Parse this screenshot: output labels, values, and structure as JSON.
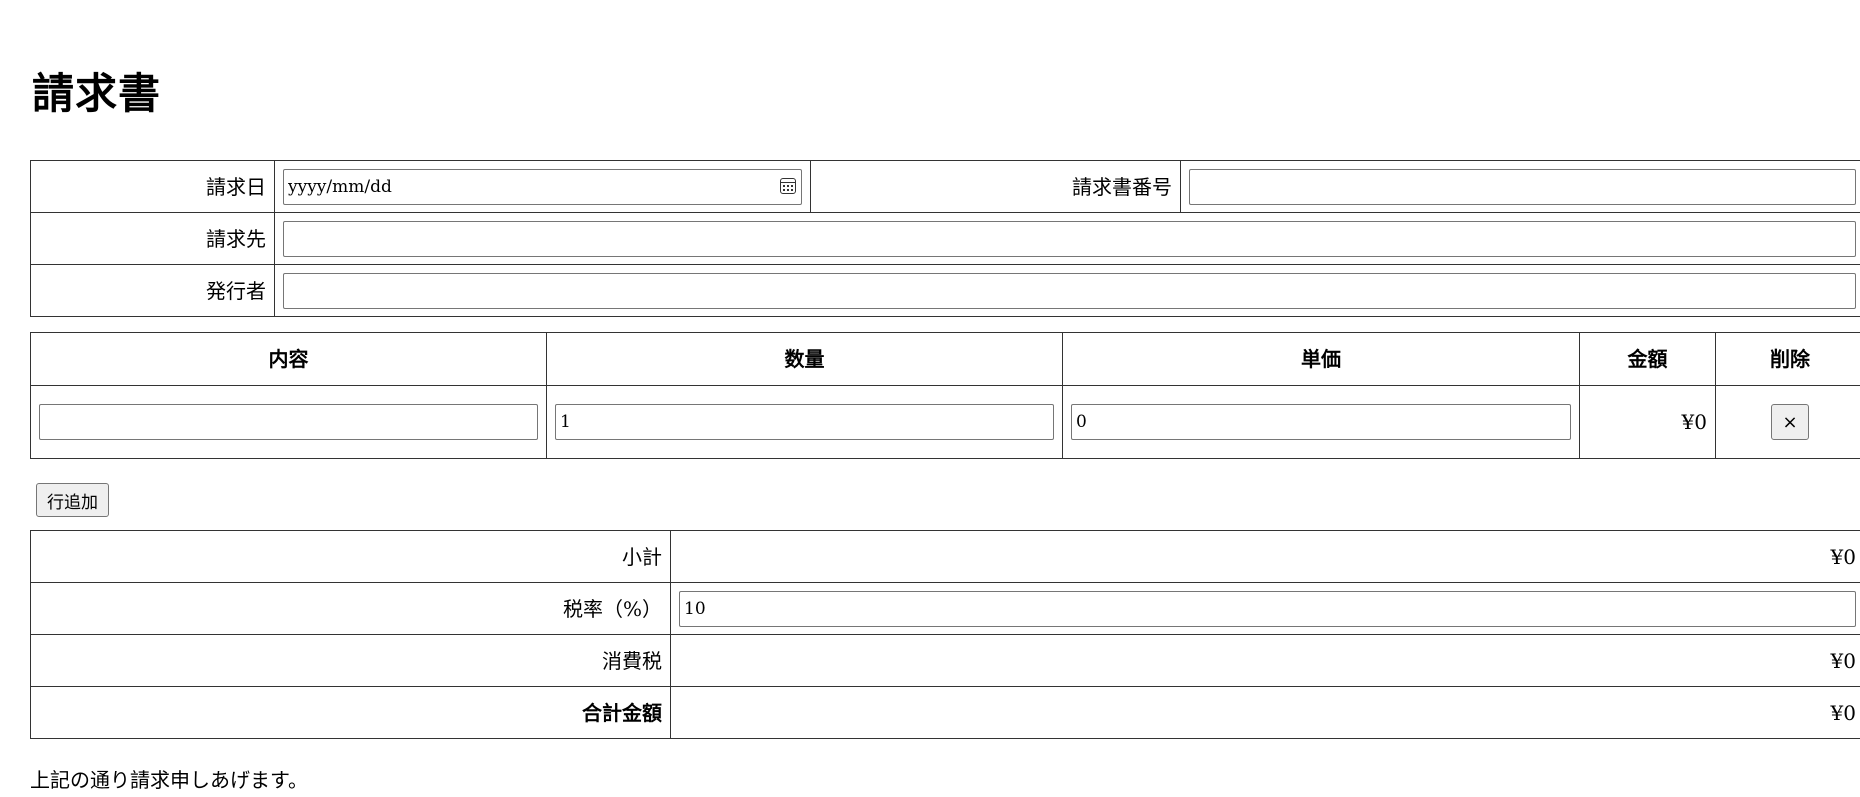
{
  "title": "請求書",
  "info": {
    "date_label": "請求日",
    "date_placeholder": "yyyy/mm/dd",
    "number_label": "請求書番号",
    "number_value": "",
    "client_label": "請求先",
    "client_value": "",
    "issuer_label": "発行者",
    "issuer_value": ""
  },
  "items": {
    "headers": [
      "内容",
      "数量",
      "単価",
      "金額",
      "削除"
    ],
    "rows": [
      {
        "content": "",
        "quantity": "1",
        "unit_price": "0",
        "amount": "¥0",
        "delete_label": "×"
      }
    ],
    "add_row_label": "行追加"
  },
  "totals": {
    "subtotal_label": "小計",
    "subtotal_value": "¥0",
    "tax_rate_label": "税率（%）",
    "tax_rate_value": "10",
    "tax_label": "消費税",
    "tax_value": "¥0",
    "grand_label": "合計金額",
    "grand_value": "¥0"
  },
  "closing": "上記の通り請求申しあげます。",
  "icons": {
    "date_picker": "calendar-icon"
  }
}
